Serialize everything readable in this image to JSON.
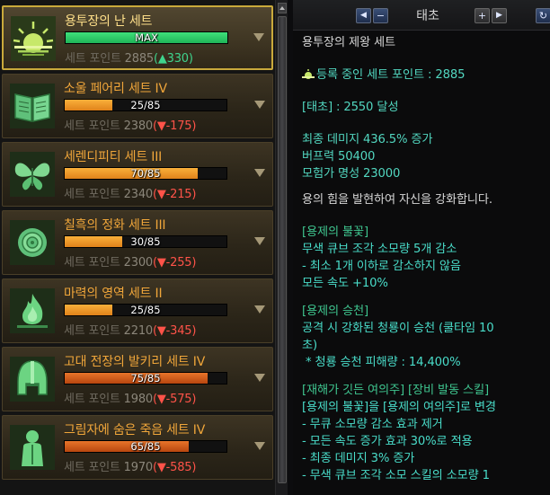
{
  "sets": [
    {
      "name": "용투장의 난 세트",
      "progress_text": "MAX",
      "progress": 1.0,
      "bar_color": "#2fd06a",
      "points_label": "세트 포인트",
      "points": "2885",
      "delta_text": "(▲330)",
      "delta_dir": "up",
      "icon": "sunrise-icon",
      "selected": true
    },
    {
      "name": "소울 페어리 세트 IV",
      "progress_text": "25/85",
      "progress": 0.2941,
      "bar_color": "#f4a232",
      "points_label": "세트 포인트",
      "points": "2380",
      "delta_text": "(▼-175)",
      "delta_dir": "down",
      "icon": "book-icon",
      "selected": false
    },
    {
      "name": "세렌디피티 세트 III",
      "progress_text": "70/85",
      "progress": 0.8235,
      "bar_color": "#f4a232",
      "points_label": "세트 포인트",
      "points": "2340",
      "delta_text": "(▼-215)",
      "delta_dir": "down",
      "icon": "butterfly-icon",
      "selected": false
    },
    {
      "name": "칠흑의 정화 세트 III",
      "progress_text": "30/85",
      "progress": 0.3529,
      "bar_color": "#f4a232",
      "points_label": "세트 포인트",
      "points": "2300",
      "delta_text": "(▼-255)",
      "delta_dir": "down",
      "icon": "rose-icon",
      "selected": false
    },
    {
      "name": "마력의 영역 세트 II",
      "progress_text": "25/85",
      "progress": 0.2941,
      "bar_color": "#f4a232",
      "points_label": "세트 포인트",
      "points": "2210",
      "delta_text": "(▼-345)",
      "delta_dir": "down",
      "icon": "flame-icon",
      "selected": false
    },
    {
      "name": "고대 전장의 발키리 세트 IV",
      "progress_text": "75/85",
      "progress": 0.8824,
      "bar_color": "#d4611c",
      "points_label": "세트 포인트",
      "points": "1980",
      "delta_text": "(▼-575)",
      "delta_dir": "down",
      "icon": "helmet-icon",
      "selected": false
    },
    {
      "name": "그림자에 숨은 죽음 세트 IV",
      "progress_text": "65/85",
      "progress": 0.7647,
      "bar_color": "#d4611c",
      "points_label": "세트 포인트",
      "points": "1970",
      "delta_text": "(▼-585)",
      "delta_dir": "down",
      "icon": "shadow-figure-icon",
      "selected": false
    }
  ],
  "header": {
    "prev_label": "◀",
    "minus_label": "−",
    "title": "태초",
    "plus_label": "+",
    "next_label": "▶",
    "refresh_label": "↻"
  },
  "detail": {
    "set_name": "용투장의 제왕 세트",
    "registered_points": "등록 중인 세트 포인트 : 2885",
    "tier_achieved": "[태초] : 2550 달성",
    "stat_final_damage": "최종 데미지 436.5% 증가",
    "stat_buff_power": "버프력 50400",
    "stat_adventurer_fame": "모험가 명성 23000",
    "description": "용의 힘을 발현하여 자신을 강화합니다.",
    "section1_title": "[용제의 불꽃]",
    "section1_line1": "무색 큐브 조각 소모량 5개 감소",
    "section1_line2": "- 최소 1개 이하로 감소하지 않음",
    "section1_line3": "모든 속도 +10%",
    "section2_title": "[용제의 승천]",
    "section2_line1": "공격 시 강화된 청룡이 승천 (쿨타임 10",
    "section2_line2": "초)",
    "section2_line3": "* 청룡 승천 피해량 : 14,400%",
    "section3_title": "[재해가 깃든 여의주] [장비 발동 스킬]",
    "section3_line1": "[용제의 불꽃]을 [용제의 여의주]로 변경",
    "section3_line2": "- 무큐 소모량 감소 효과 제거",
    "section3_line3": "- 모든 속도 증가 효과 30%로 적용",
    "section3_line4": "- 최종 데미지 3% 증가",
    "section3_line5": "- 무색 큐브 조각 소모 스킬의 소모량 1"
  },
  "colors": {
    "title_gold": "#f0a63a",
    "selected_border": "#c9a93b",
    "delta_up": "#3fd48d",
    "delta_down": "#ff5349",
    "stat_teal": "#52d7c0",
    "section_green": "#3fc58f"
  }
}
